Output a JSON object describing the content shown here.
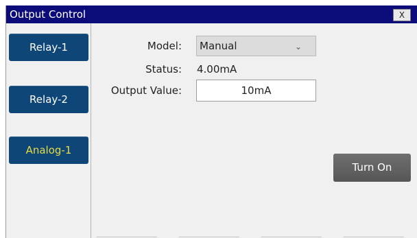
{
  "window": {
    "title": "Output Control",
    "close_label": "X"
  },
  "sidebar": {
    "items": [
      {
        "label": "Relay-1",
        "active": false
      },
      {
        "label": "Relay-2",
        "active": false
      },
      {
        "label": "Analog-1",
        "active": true
      }
    ]
  },
  "form": {
    "model_label": "Model:",
    "model_value": "Manual",
    "status_label": "Status:",
    "status_value": "4.00mA",
    "output_label": "Output Value:",
    "output_value": "10mA"
  },
  "actions": {
    "turn_on_label": "Turn On"
  },
  "colors": {
    "titlebar": "#0b0b7a",
    "sidebar_button": "#0d4677",
    "active_text": "#e6dc44",
    "action_button": "#616161"
  }
}
